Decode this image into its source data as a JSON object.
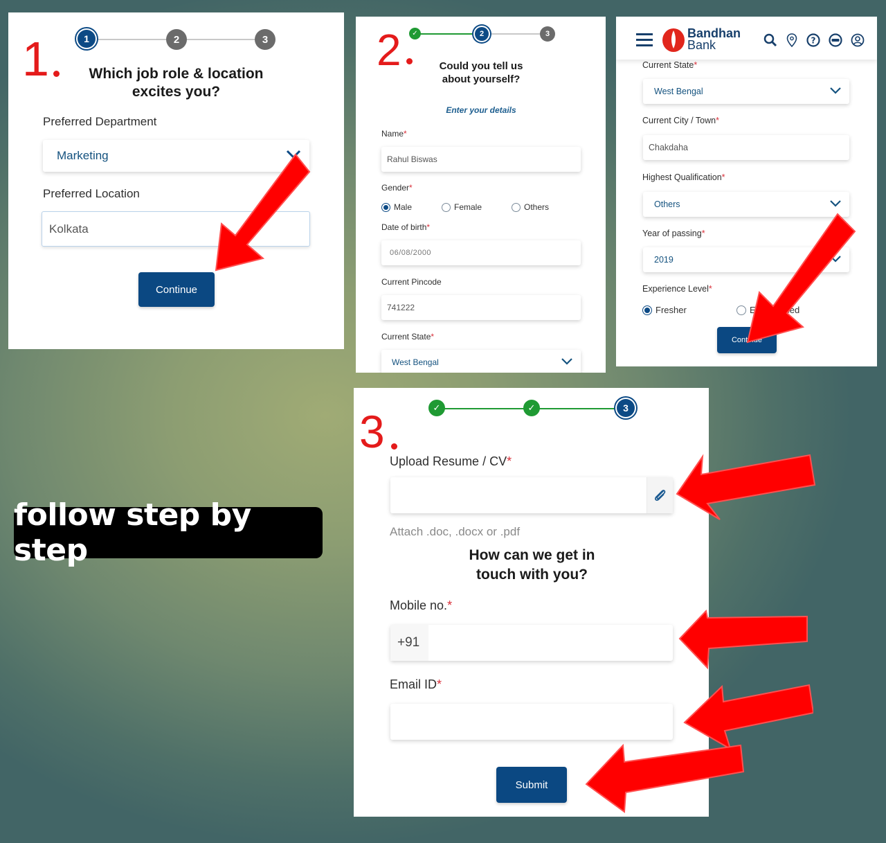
{
  "tagline": "follow step by step",
  "colors": {
    "accent_blue": "#0b4882",
    "step_done_green": "#1f9a33",
    "step_pending_gray": "#6b6b6b",
    "annotation_red": "#e41b1b",
    "required_asterisk": "#d9303a"
  },
  "step1": {
    "number_label": "1",
    "stepper": [
      "1",
      "2",
      "3"
    ],
    "heading_line1": "Which job role & location",
    "heading_line2": "excites you?",
    "department_label": "Preferred Department",
    "department_value": "Marketing",
    "location_label": "Preferred Location",
    "location_value": "Kolkata",
    "continue_label": "Continue"
  },
  "step2": {
    "number_label": "2",
    "stepper": [
      "✓",
      "2",
      "3"
    ],
    "heading_line1": "Could you tell us",
    "heading_line2": "about yourself?",
    "subheading": "Enter your details",
    "name_label": "Name",
    "name_value": "Rahul Biswas",
    "gender_label": "Gender",
    "gender_options": [
      "Male",
      "Female",
      "Others"
    ],
    "gender_selected": "Male",
    "dob_label": "Date of birth",
    "dob_value": "06/08/2000",
    "pincode_label": "Current Pincode",
    "pincode_value": "741222",
    "state_label": "Current State",
    "state_value": "West Bengal",
    "required_mark": "*"
  },
  "bank_panel": {
    "brand_line1": "Bandhan",
    "brand_line2": "Bank",
    "header_icons": [
      "menu-icon",
      "search-icon",
      "location-pin-icon",
      "help-icon",
      "nri-icon",
      "user-icon"
    ],
    "state_label": "Current State",
    "state_value": "West Bengal",
    "city_label": "Current City / Town",
    "city_value": "Chakdaha",
    "qualification_label": "Highest Qualification",
    "qualification_value": "Others",
    "year_label": "Year of passing",
    "year_value": "2019",
    "experience_label": "Experience Level",
    "experience_options": [
      "Fresher",
      "Experienced"
    ],
    "experience_selected": "Fresher",
    "continue_label": "Continue"
  },
  "step3": {
    "number_label": "3",
    "stepper": [
      "✓",
      "✓",
      "3"
    ],
    "resume_label": "Upload Resume / CV",
    "resume_value": "",
    "resume_hint": "Attach .doc, .docx or .pdf",
    "heading_line1": "How can we get in",
    "heading_line2": "touch with you?",
    "mobile_label": "Mobile no.",
    "mobile_prefix": "+91",
    "mobile_value": "",
    "email_label": "Email ID",
    "email_value": "",
    "submit_label": "Submit"
  }
}
